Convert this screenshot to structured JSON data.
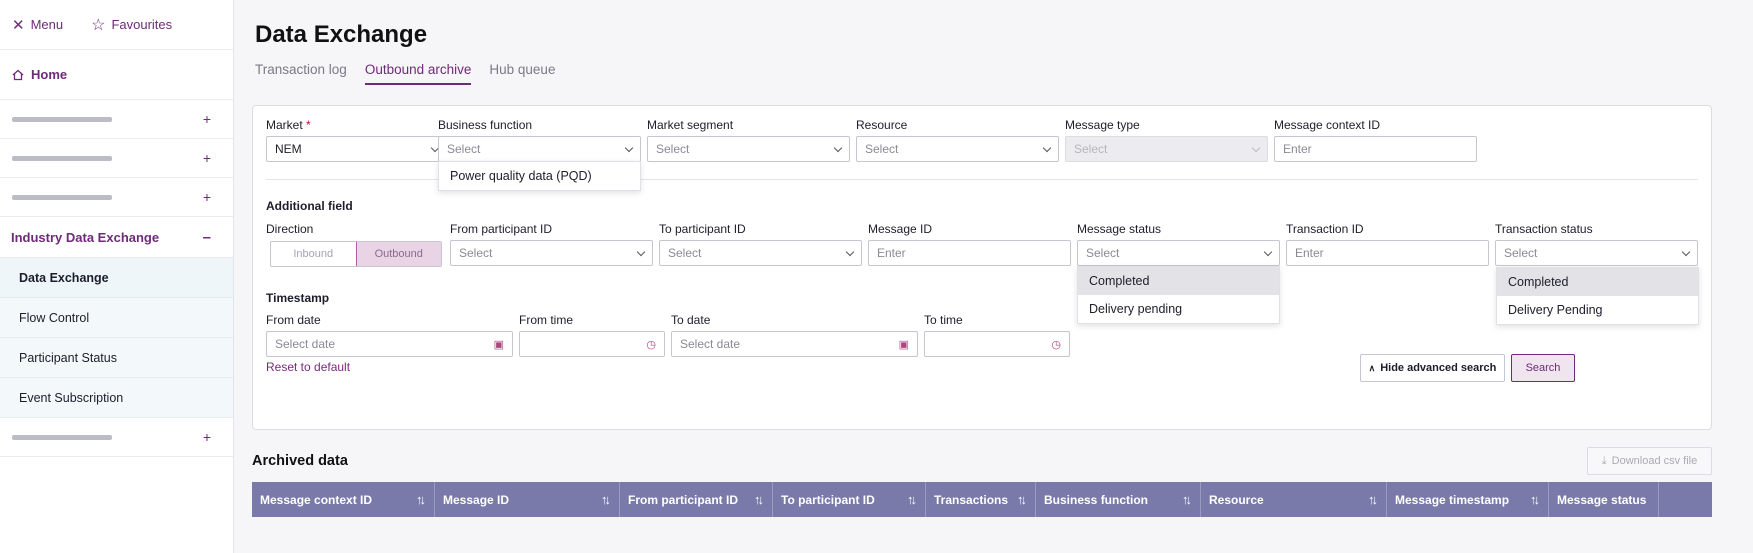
{
  "sidebar": {
    "menu_label": "Menu",
    "favourites_label": "Favourites",
    "home_label": "Home",
    "group_label": "Industry Data Exchange",
    "sub_items": [
      {
        "label": "Data Exchange"
      },
      {
        "label": "Flow Control"
      },
      {
        "label": "Participant Status"
      },
      {
        "label": "Event Subscription"
      }
    ]
  },
  "page": {
    "title": "Data Exchange",
    "tabs": [
      {
        "label": "Transaction log"
      },
      {
        "label": "Outbound archive"
      },
      {
        "label": "Hub queue"
      }
    ]
  },
  "filters": {
    "market": {
      "label": "Market",
      "required_mark": "*",
      "value": "NEM"
    },
    "business_function": {
      "label": "Business function",
      "placeholder": "Select",
      "options": [
        "Power quality data (PQD)"
      ]
    },
    "market_segment": {
      "label": "Market segment",
      "placeholder": "Select"
    },
    "resource": {
      "label": "Resource",
      "placeholder": "Select"
    },
    "message_type": {
      "label": "Message type",
      "placeholder": "Select"
    },
    "message_context_id": {
      "label": "Message context ID",
      "placeholder": "Enter"
    },
    "additional_field_label": "Additional field",
    "direction": {
      "label": "Direction",
      "options": [
        "Inbound",
        "Outbound"
      ],
      "selected": "Outbound"
    },
    "from_participant_id": {
      "label": "From participant ID",
      "placeholder": "Select"
    },
    "to_participant_id": {
      "label": "To participant ID",
      "placeholder": "Select"
    },
    "message_id": {
      "label": "Message ID",
      "placeholder": "Enter"
    },
    "message_status": {
      "label": "Message status",
      "placeholder": "Select",
      "options": [
        "Completed",
        "Delivery pending"
      ]
    },
    "transaction_id": {
      "label": "Transaction ID",
      "placeholder": "Enter"
    },
    "transaction_status": {
      "label": "Transaction status",
      "placeholder": "Select",
      "options": [
        "Completed",
        "Delivery Pending"
      ]
    },
    "timestamp_label": "Timestamp",
    "from_date": {
      "label": "From date",
      "placeholder": "Select date"
    },
    "from_time": {
      "label": "From time"
    },
    "to_date": {
      "label": "To date",
      "placeholder": "Select date"
    },
    "to_time": {
      "label": "To time"
    },
    "reset_label": "Reset to default",
    "hide_advanced_label": "Hide advanced search",
    "search_label": "Search"
  },
  "archive": {
    "title": "Archived data",
    "download_label": "Download csv file",
    "columns": [
      "Message context ID",
      "Message ID",
      "From participant ID",
      "To participant ID",
      "Transactions",
      "Business function",
      "Resource",
      "Message timestamp",
      "Message status"
    ]
  }
}
